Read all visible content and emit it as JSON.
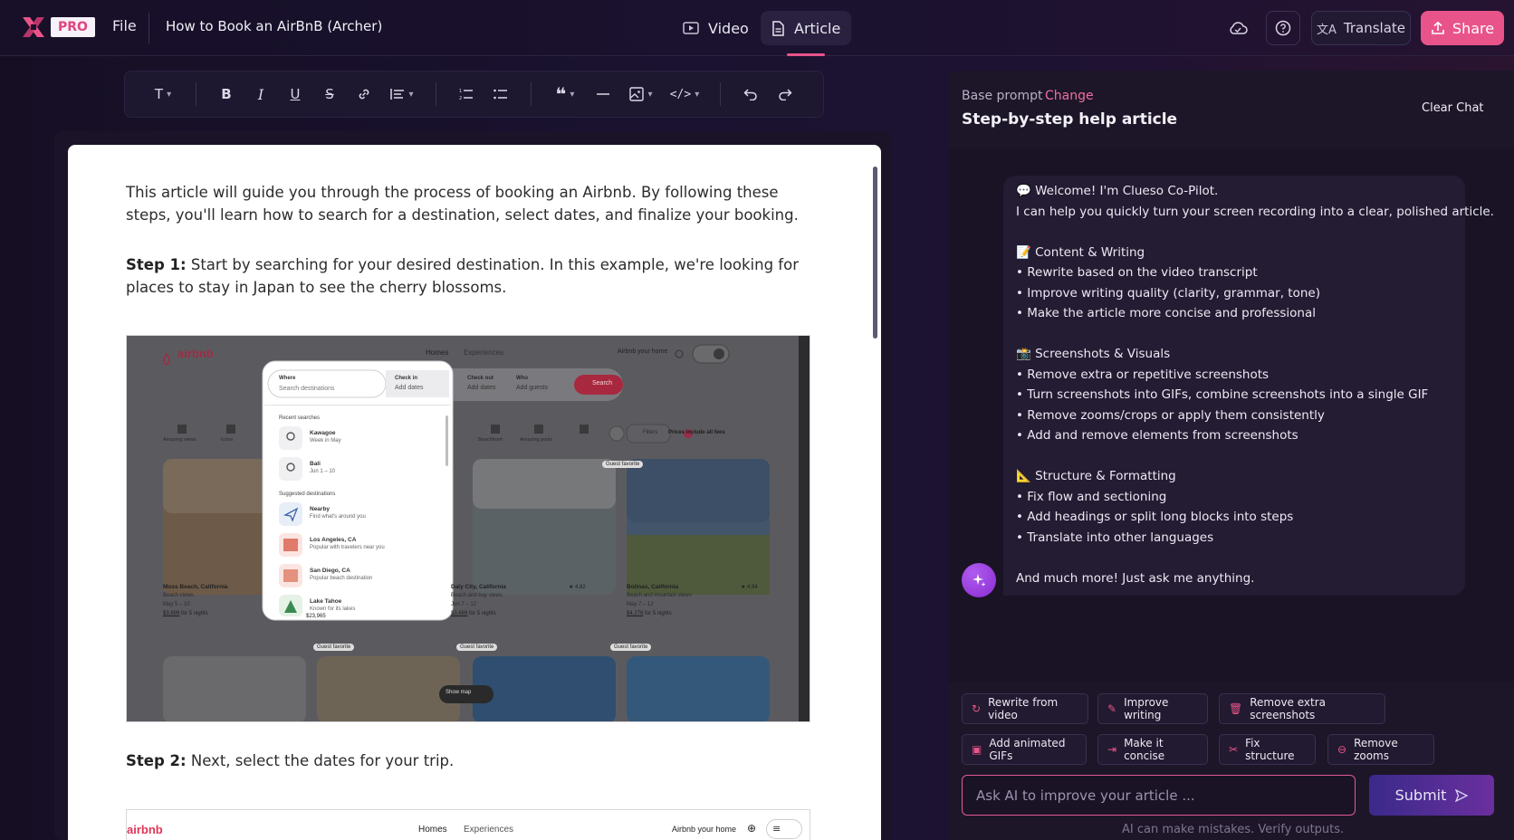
{
  "header": {
    "pro_badge": "PRO",
    "file_menu": "File",
    "doc_title": "How to Book an AirBnB (Archer)",
    "tabs": [
      {
        "label": "Video",
        "icon": "video-icon"
      },
      {
        "label": "Article",
        "icon": "document-icon",
        "active": true
      }
    ],
    "translate_label": "Translate",
    "share_label": "Share",
    "accent": "#e8548a"
  },
  "toolbar": {
    "text_style": "T"
  },
  "article": {
    "intro": "This article will guide you through the process of booking an Airbnb. By following these steps, you'll learn how to search for a destination, select dates, and finalize your booking.",
    "steps": [
      {
        "label": "Step 1:",
        "text": " Start by searching for your desired destination. In this example, we're looking for places to stay in Japan to see the cherry blossoms."
      },
      {
        "label": "Step 2:",
        "text": " Next, select the dates for your trip."
      }
    ],
    "screenshot1": {
      "brand": "airbnb",
      "nav": [
        "Homes",
        "Experiences"
      ],
      "host_link": "Airbnb your home",
      "where_label": "Where",
      "where_placeholder": "Search destinations",
      "checkin": "Check in",
      "checkin_sub": "Add dates",
      "checkout": "Check out",
      "checkout_sub": "Add dates",
      "who": "Who",
      "who_sub": "Add guests",
      "search": "Search",
      "recent_title": "Recent searches",
      "recent": [
        {
          "name": "Kawagoe",
          "sub": "Week in May"
        },
        {
          "name": "Bali",
          "sub": "Jun 1 – 10"
        }
      ],
      "suggested_title": "Suggested destinations",
      "suggested": [
        {
          "name": "Nearby",
          "sub": "Find what's around you"
        },
        {
          "name": "Los Angeles, CA",
          "sub": "Popular with travelers near you"
        },
        {
          "name": "San Diego, CA",
          "sub": "Popular beach destination"
        },
        {
          "name": "Lake Tahoe",
          "sub": "Known for its lakes"
        }
      ],
      "categories": [
        "Amazing views",
        "Icons",
        "Beachfront",
        "Amazing pools"
      ],
      "filters": "Filters",
      "prices_toggle": "Prices include all fees",
      "listings": [
        {
          "title": "Moss Beach, California",
          "sub": "Beach views",
          "dates": "May 5 – 10",
          "price": "$3,699",
          "price_suffix": "for 5 nights"
        },
        {
          "title": "Daly City, California",
          "sub": "Beach and bay views",
          "dates": "Jun 7 – 12",
          "price": "$3,689",
          "price_suffix": "for 5 nights",
          "rating": "★ 4.82"
        },
        {
          "title": "Bolinas, California",
          "sub": "Beach and mountain views",
          "dates": "May 7 – 12",
          "price": "$4,276",
          "price_suffix": "for 5 nights",
          "rating": "★ 4.94"
        }
      ],
      "guest_favorite": "Guest favorite",
      "show_map": "Show map",
      "partial_price": "$23,965"
    },
    "screenshot2": {
      "brand": "airbnb",
      "nav": [
        "Homes",
        "Experiences"
      ],
      "host_link": "Airbnb your home"
    }
  },
  "panel": {
    "base_prompt_label": "Base prompt",
    "change_label": "Change",
    "prompt_title": "Step-by-step help article",
    "clear_chat": "Clear Chat",
    "message": [
      "💬 Welcome! I'm Clueso Co-Pilot.",
      "I can help you quickly turn your screen recording into a clear, polished article.",
      "",
      "📝 Content & Writing",
      "• Rewrite based on the video transcript",
      "• Improve writing quality (clarity, grammar, tone)",
      "• Make the article more concise and professional",
      "",
      "📸 Screenshots & Visuals",
      "• Remove extra or repetitive screenshots",
      "• Turn screenshots into GIFs, combine screenshots into a single GIF",
      "• Remove zooms/crops or apply them consistently",
      "• Add and remove elements from screenshots",
      "",
      "📐 Structure & Formatting",
      "• Fix flow and sectioning",
      "• Add headings or split long blocks into steps",
      "• Translate into other languages",
      "",
      "And much more! Just ask me anything."
    ],
    "chips_row1": [
      {
        "label": "Rewrite from video",
        "icon": "refresh-icon"
      },
      {
        "label": "Improve writing",
        "icon": "sparkle-pen-icon"
      },
      {
        "label": "Remove extra screenshots",
        "icon": "trash-icon"
      }
    ],
    "chips_row2": [
      {
        "label": "Add animated GIFs",
        "icon": "gif-icon"
      },
      {
        "label": "Make it concise",
        "icon": "compress-icon"
      },
      {
        "label": "Fix structure",
        "icon": "scissors-icon"
      },
      {
        "label": "Remove zooms",
        "icon": "zoom-out-icon"
      }
    ],
    "input_placeholder": "Ask AI to improve your article ...",
    "submit_label": "Submit",
    "disclaimer": "AI can make mistakes. Verify outputs."
  }
}
